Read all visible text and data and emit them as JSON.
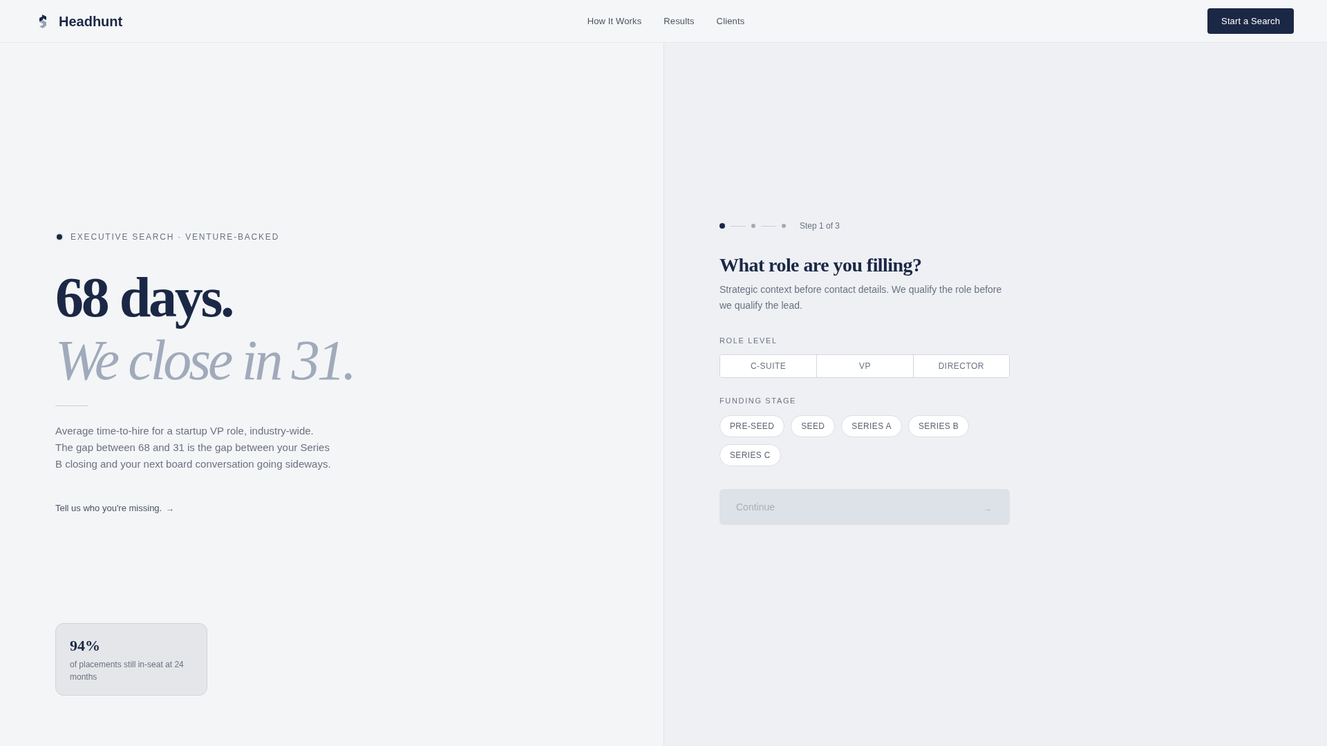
{
  "header": {
    "brand": "Headhunt",
    "nav": [
      {
        "label": "How It Works"
      },
      {
        "label": "Results"
      },
      {
        "label": "Clients"
      }
    ],
    "cta": "Start a Search"
  },
  "hero": {
    "eyebrow": "EXECUTIVE SEARCH · VENTURE-BACKED",
    "headline": "68 days.",
    "subheadline": "We close in 31.",
    "body": [
      "Average time-to-hire for a startup VP role, industry-wide.",
      "The gap between 68 and 31 is the gap between your Series B closing and your next board conversation going sideways."
    ],
    "link": {
      "label": "Tell us who you're missing.",
      "arrow": "→"
    },
    "stat": {
      "value": "94%",
      "caption": "of placements still in-seat at 24 months"
    }
  },
  "form": {
    "steps": [
      {
        "selected": true
      },
      {
        "selected": false
      },
      {
        "selected": false
      }
    ],
    "step_label": "Step 1 of 3",
    "title": "What role are you filling?",
    "description": "Strategic context before contact details. We qualify the role before we qualify the lead.",
    "role_level": {
      "label": "ROLE LEVEL",
      "options": [
        {
          "label": "C-SUITE",
          "selected": false
        },
        {
          "label": "VP",
          "selected": false
        },
        {
          "label": "DIRECTOR",
          "selected": false
        }
      ]
    },
    "funding_stage": {
      "label": "FUNDING STAGE",
      "options": [
        {
          "label": "PRE-SEED",
          "selected": false
        },
        {
          "label": "SEED",
          "selected": false
        },
        {
          "label": "SERIES A",
          "selected": false
        },
        {
          "label": "SERIES B",
          "selected": false
        },
        {
          "label": "SERIES C",
          "selected": false
        }
      ]
    },
    "continue": {
      "label": "Continue",
      "arrow": "→",
      "disabled": true
    }
  }
}
